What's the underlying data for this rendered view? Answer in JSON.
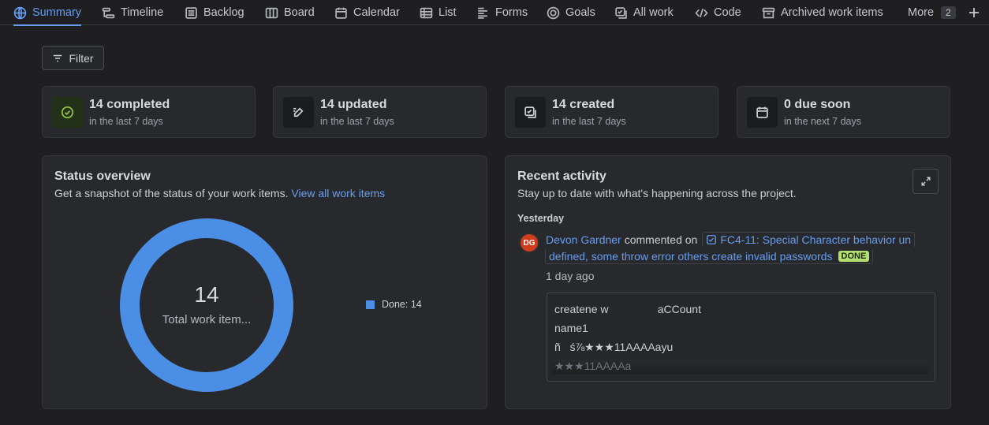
{
  "tabs": [
    {
      "label": "Summary",
      "icon": "globe-icon",
      "active": true
    },
    {
      "label": "Timeline",
      "icon": "timeline-icon"
    },
    {
      "label": "Backlog",
      "icon": "backlog-icon"
    },
    {
      "label": "Board",
      "icon": "board-icon"
    },
    {
      "label": "Calendar",
      "icon": "calendar-icon"
    },
    {
      "label": "List",
      "icon": "list-icon"
    },
    {
      "label": "Forms",
      "icon": "forms-icon"
    },
    {
      "label": "Goals",
      "icon": "goals-icon"
    },
    {
      "label": "All work",
      "icon": "all-work-icon"
    },
    {
      "label": "Code",
      "icon": "code-icon"
    },
    {
      "label": "Archived work items",
      "icon": "archive-icon"
    },
    {
      "label": "More",
      "badge": "2"
    }
  ],
  "filter": {
    "label": "Filter"
  },
  "stats": [
    {
      "title": "14 completed",
      "sub": "in the last 7 days",
      "icon": "check-circle-icon"
    },
    {
      "title": "14 updated",
      "sub": "in the last 7 days",
      "icon": "edit-icon"
    },
    {
      "title": "14 created",
      "sub": "in the last 7 days",
      "icon": "created-icon"
    },
    {
      "title": "0 due soon",
      "sub": "in the next 7 days",
      "icon": "calendar-icon"
    }
  ],
  "status_overview": {
    "title": "Status overview",
    "description": "Get a snapshot of the status of your work items.",
    "link": "View all work items",
    "total": "14",
    "total_label": "Total work item...",
    "legend": [
      {
        "label": "Done: 14",
        "value": 14,
        "color": "#4b8ee6"
      }
    ]
  },
  "recent_activity": {
    "title": "Recent activity",
    "description": "Stay up to date with what's happening across the project.",
    "day": "Yesterday",
    "item": {
      "avatar": "DG",
      "user": "Devon Gardner",
      "action": "commented on",
      "issue_line1": "FC4-11: Special Character behavior un",
      "issue_line2": "defined, some throw error others create invalid passwords",
      "status": "DONE",
      "time": "1 day ago",
      "comment_lines": [
        "createne w                aCCount",
        "name1",
        "ñ   ś⅞★★★11AAAAayu",
        "★★★11AAAAa"
      ]
    }
  }
}
